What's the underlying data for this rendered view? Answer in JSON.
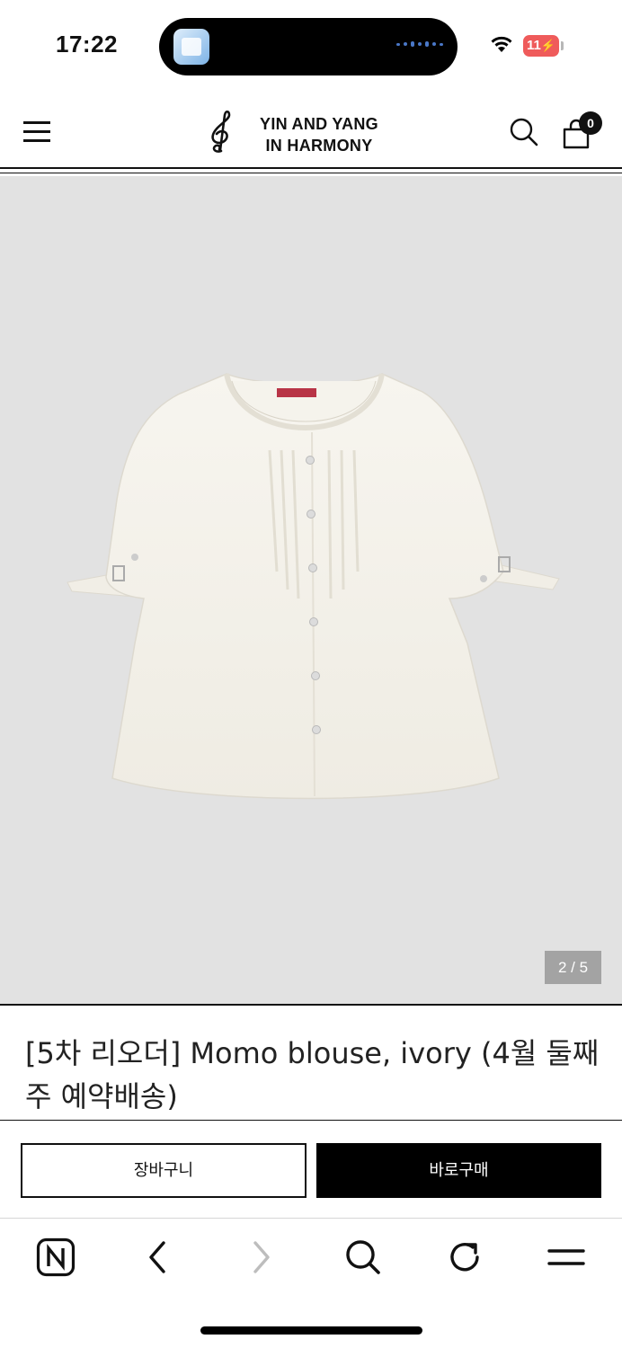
{
  "status_bar": {
    "time": "17:22",
    "battery": "11"
  },
  "header": {
    "logo_line1": "YIN AND YANG",
    "logo_line2": "IN HARMONY",
    "cart_count": "0",
    "icons": [
      "menu-icon",
      "treble-clef-logo",
      "search-icon",
      "shopping-bag-icon"
    ]
  },
  "gallery": {
    "counter": "2 / 5",
    "current_index": 2,
    "total": 5,
    "background_color": "#e2e2e2"
  },
  "product": {
    "title": "[5차 리오더] Momo blouse, ivory (4월 둘째주 예약배송)"
  },
  "buy_bar": {
    "cart_label": "장바구니",
    "buy_label": "바로구매"
  },
  "browser_toolbar": {
    "icons": [
      "naver-home-icon",
      "back-icon",
      "forward-icon",
      "search-icon",
      "reload-icon",
      "menu-icon"
    ]
  },
  "colors": {
    "accent": "#000000",
    "battery_low": "#ef5b5b"
  }
}
